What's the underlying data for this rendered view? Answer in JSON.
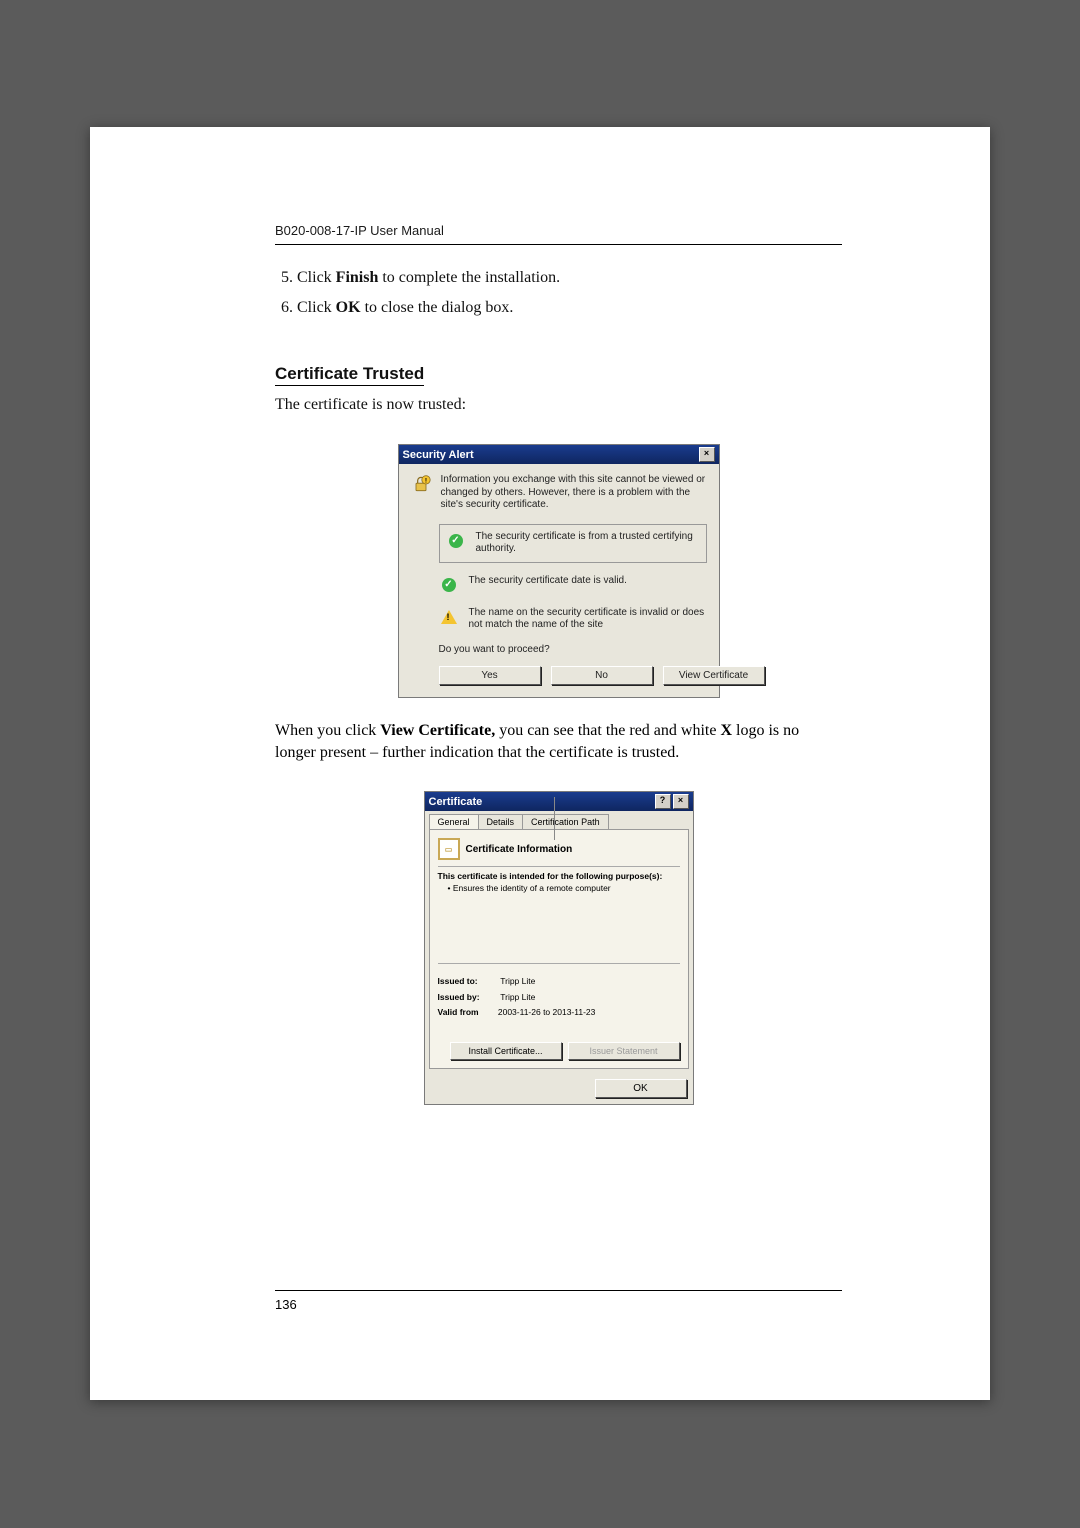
{
  "header": "B020-008-17-IP User Manual",
  "steps": {
    "s5": {
      "prefix": "Click ",
      "bold": "Finish",
      "rest": " to complete the installation."
    },
    "s6": {
      "prefix": "Click ",
      "bold": "OK",
      "rest": " to close the dialog box."
    }
  },
  "section_title": "Certificate Trusted",
  "section_intro": "The certificate is now trusted:",
  "security_alert": {
    "title": "Security Alert",
    "close": "×",
    "msg": "Information you exchange with this site cannot be viewed or changed by others. However, there is a problem with the site's security certificate.",
    "line1": "The security certificate is from a trusted certifying authority.",
    "line2": "The security certificate date is valid.",
    "line3": "The name on the security certificate is invalid or does not match the name of the site",
    "proceed": "Do you want to proceed?",
    "yes": "Yes",
    "no": "No",
    "view": "View Certificate"
  },
  "para": {
    "p1": "When you click ",
    "b1": "View Certificate,",
    "p2": " you can see that the red and white ",
    "b2": "X",
    "p3": " logo is no longer present – further indication that the certificate is trusted."
  },
  "cert": {
    "title": "Certificate",
    "help": "?",
    "close": "×",
    "tabs": {
      "general": "General",
      "details": "Details",
      "path": "Certification Path"
    },
    "info_title": "Certificate Information",
    "purpose_hdr": "This certificate is intended for the following purpose(s):",
    "purpose_item": "• Ensures the identity of a remote computer",
    "issued_to_l": "Issued to:",
    "issued_to_v": "Tripp Lite",
    "issued_by_l": "Issued by:",
    "issued_by_v": "Tripp Lite",
    "valid_l": "Valid from",
    "valid_v": " 2003-11-26  to  2013-11-23",
    "install": "Install Certificate...",
    "issuer_stmt": "Issuer Statement",
    "ok": "OK"
  },
  "page_number": "136"
}
